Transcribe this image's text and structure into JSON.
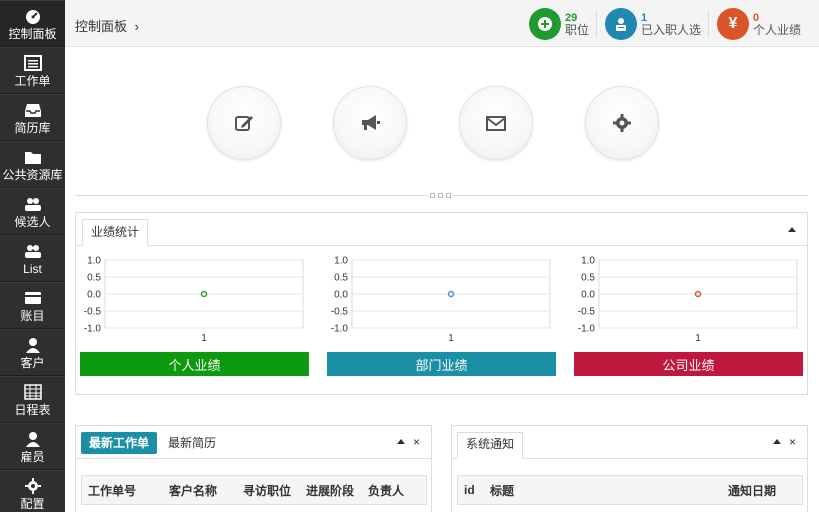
{
  "sidebar": {
    "items": [
      {
        "label": "控制面板",
        "icon": "dashboard-icon"
      },
      {
        "label": "工作单",
        "icon": "list-icon"
      },
      {
        "label": "简历库",
        "icon": "inbox-icon"
      },
      {
        "label": "公共资源库",
        "icon": "folder-icon"
      },
      {
        "label": "候选人",
        "icon": "users-icon"
      },
      {
        "label": "List",
        "icon": "users-icon"
      },
      {
        "label": "账目",
        "icon": "card-icon"
      },
      {
        "label": "客户",
        "icon": "user-icon"
      },
      {
        "label": "日程表",
        "icon": "calendar-icon"
      },
      {
        "label": "雇员",
        "icon": "user-icon"
      },
      {
        "label": "配置",
        "icon": "gear-icon"
      }
    ]
  },
  "header": {
    "breadcrumb": "控制面板",
    "breadcrumb_sep": "›",
    "stats": [
      {
        "count": "29",
        "label": "职位",
        "color": "#1f9a2e",
        "icon": "plus-icon"
      },
      {
        "count": "1",
        "label": "已入职人选",
        "color": "#2188b3",
        "icon": "user-badge-icon"
      },
      {
        "count": "0",
        "label": "个人业绩",
        "color": "#d9542b",
        "icon": "yen-icon"
      }
    ]
  },
  "quick_actions": [
    {
      "icon": "edit-icon"
    },
    {
      "icon": "megaphone-icon"
    },
    {
      "icon": "envelope-icon"
    },
    {
      "icon": "gear-icon"
    }
  ],
  "performance": {
    "tab": "业绩统计",
    "charts": [
      {
        "label": "个人业绩",
        "label_color": "#0e9a0e",
        "point_color": "#2e9d2e"
      },
      {
        "label": "部门业绩",
        "label_color": "#1a8fa6",
        "point_color": "#4a90d9"
      },
      {
        "label": "公司业绩",
        "label_color": "#c0173f",
        "point_color": "#d9542b"
      }
    ]
  },
  "chart_data": [
    {
      "type": "scatter",
      "x": [
        1
      ],
      "y": [
        0.0
      ],
      "ylim": [
        -1.0,
        1.0
      ],
      "yticks": [
        "1.0",
        "0.5",
        "0.0",
        "-0.5",
        "-1.0"
      ],
      "xticks": [
        "1"
      ],
      "grid": true,
      "title": "个人业绩"
    },
    {
      "type": "scatter",
      "x": [
        1
      ],
      "y": [
        0.0
      ],
      "ylim": [
        -1.0,
        1.0
      ],
      "yticks": [
        "1.0",
        "0.5",
        "0.0",
        "-0.5",
        "-1.0"
      ],
      "xticks": [
        "1"
      ],
      "grid": true,
      "title": "部门业绩"
    },
    {
      "type": "scatter",
      "x": [
        1
      ],
      "y": [
        0.0
      ],
      "ylim": [
        -1.0,
        1.0
      ],
      "yticks": [
        "1.0",
        "0.5",
        "0.0",
        "-0.5",
        "-1.0"
      ],
      "xticks": [
        "1"
      ],
      "grid": true,
      "title": "公司业绩"
    }
  ],
  "work_panel": {
    "tab_active": "最新工作单",
    "tab_other": "最新简历",
    "accent": "#1a8fa6",
    "columns": [
      "工作单号",
      "客户名称",
      "寻访职位",
      "进展阶段",
      "负责人"
    ]
  },
  "notice_panel": {
    "title": "系统通知",
    "columns": [
      "id",
      "标题",
      "通知日期"
    ]
  },
  "controls": {
    "close": "×"
  }
}
